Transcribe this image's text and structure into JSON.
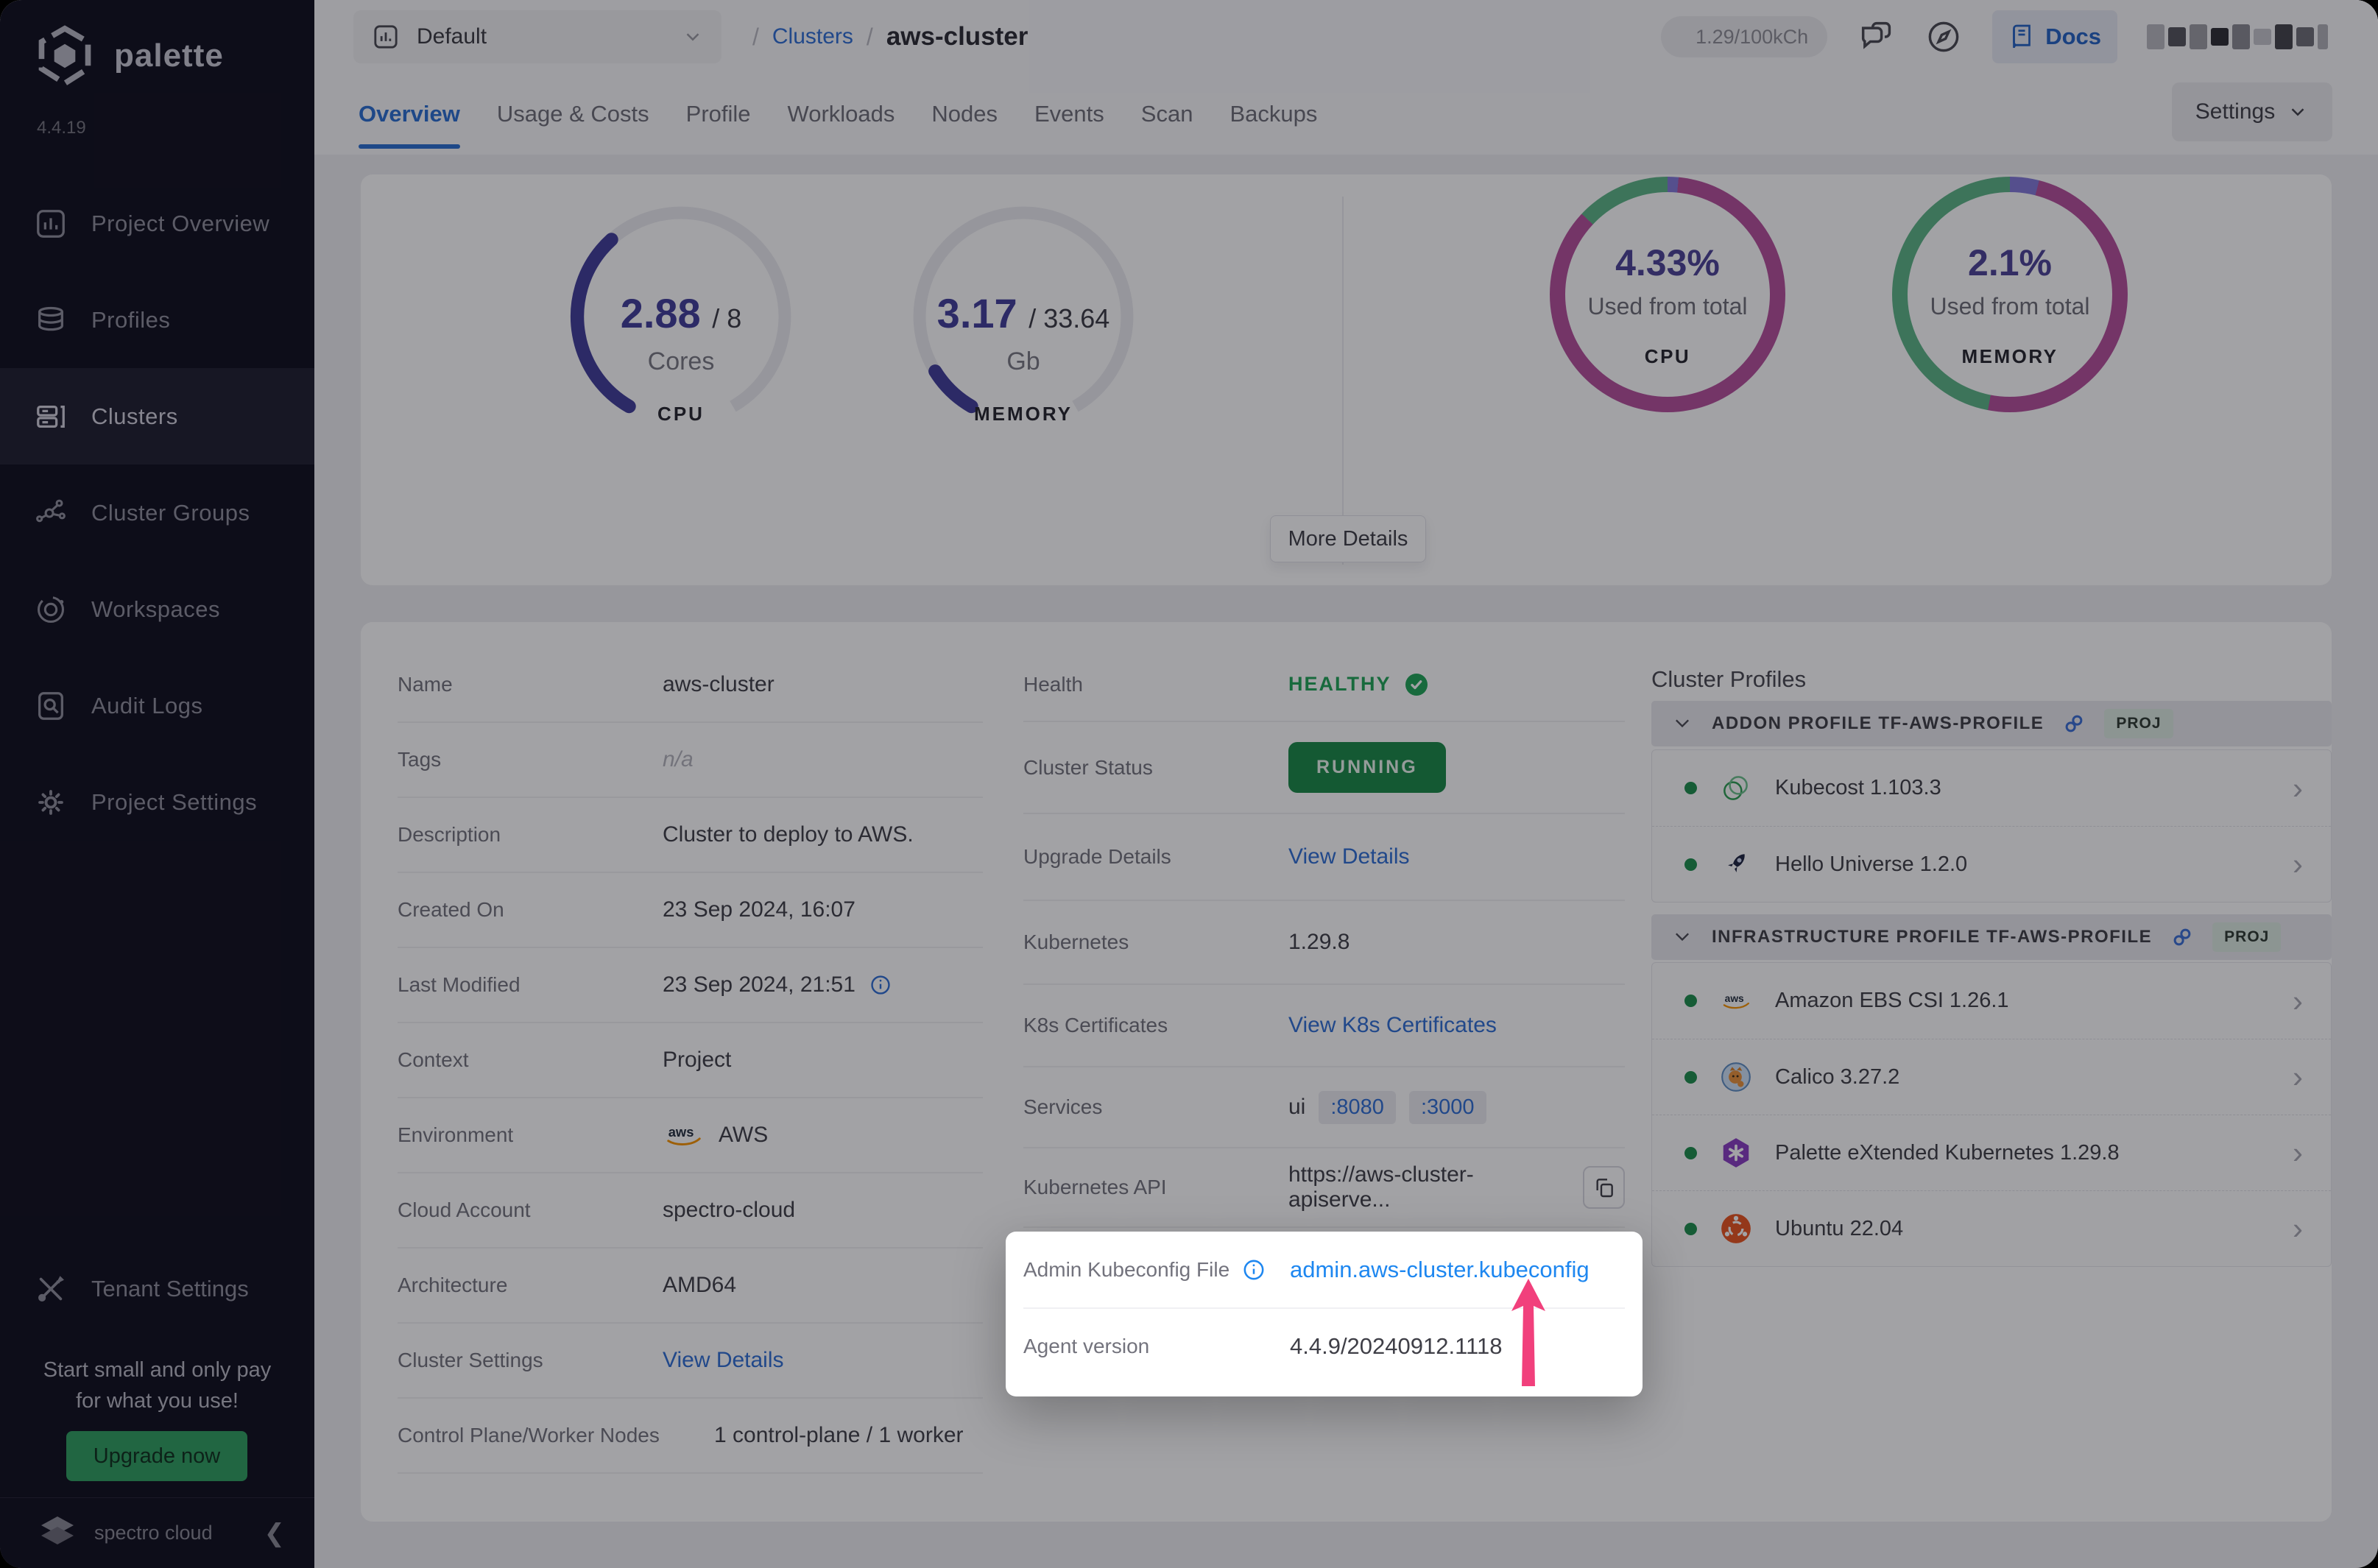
{
  "brand": {
    "name": "palette",
    "version": "4.4.19",
    "footer": "spectro cloud"
  },
  "sidebar": {
    "items": [
      {
        "label": "Project Overview",
        "icon": "bar-chart-icon"
      },
      {
        "label": "Profiles",
        "icon": "layers-icon"
      },
      {
        "label": "Clusters",
        "icon": "server-icon"
      },
      {
        "label": "Cluster Groups",
        "icon": "molecule-icon"
      },
      {
        "label": "Workspaces",
        "icon": "orbit-icon"
      },
      {
        "label": "Audit Logs",
        "icon": "audit-icon"
      },
      {
        "label": "Project Settings",
        "icon": "gear-icon"
      }
    ],
    "tenant_settings": "Tenant Settings",
    "promo": {
      "line1": "Start small and only pay",
      "line2": "for what you use!",
      "cta": "Upgrade now"
    }
  },
  "topbar": {
    "project": "Default",
    "breadcrumb": {
      "sep": "/",
      "root": "Clusters",
      "current": "aws-cluster"
    },
    "usage": "1.29/100kCh",
    "docs": "Docs"
  },
  "tabs": {
    "items": [
      "Overview",
      "Usage & Costs",
      "Profile",
      "Workloads",
      "Nodes",
      "Events",
      "Scan",
      "Backups"
    ],
    "settings": "Settings"
  },
  "overview": {
    "gauges": [
      {
        "value": "2.88",
        "total": "/ 8",
        "unit": "Cores",
        "label": "CPU",
        "pct": 36
      },
      {
        "value": "3.17",
        "total": "/ 33.64",
        "unit": "Gb",
        "label": "MEMORY",
        "pct": 9.4
      }
    ],
    "donuts": [
      {
        "value": "4.33%",
        "caption": "Used from total",
        "label": "CPU",
        "segments": [
          {
            "color": "#8379d8",
            "pct": 1.5
          },
          {
            "color": "#b5509c",
            "pct": 85.5
          },
          {
            "color": "#5cb586",
            "pct": 13
          }
        ]
      },
      {
        "value": "2.1%",
        "caption": "Used from total",
        "label": "MEMORY",
        "segments": [
          {
            "color": "#8379d8",
            "pct": 4
          },
          {
            "color": "#b5509c",
            "pct": 49
          },
          {
            "color": "#5cb586",
            "pct": 47
          }
        ]
      }
    ],
    "more_details": "More Details"
  },
  "details": {
    "left": [
      {
        "label": "Name",
        "value": "aws-cluster"
      },
      {
        "label": "Tags",
        "value": "n/a"
      },
      {
        "label": "Description",
        "value": "Cluster to deploy to AWS."
      },
      {
        "label": "Created On",
        "value": "23 Sep 2024, 16:07"
      },
      {
        "label": "Last Modified",
        "value": "23 Sep 2024, 21:51"
      },
      {
        "label": "Context",
        "value": "Project"
      },
      {
        "label": "Environment",
        "value": "AWS"
      },
      {
        "label": "Cloud Account",
        "value": "spectro-cloud"
      },
      {
        "label": "Architecture",
        "value": "AMD64"
      },
      {
        "label": "Cluster Settings",
        "value": "View Details"
      },
      {
        "label": "Control Plane/Worker Nodes",
        "value": "1 control-plane / 1 worker"
      }
    ],
    "middle": [
      {
        "label": "Health",
        "value": "HEALTHY"
      },
      {
        "label": "Cluster Status",
        "value": "RUNNING"
      },
      {
        "label": "Upgrade Details",
        "value": "View Details"
      },
      {
        "label": "Kubernetes",
        "value": "1.29.8"
      },
      {
        "label": "K8s Certificates",
        "value": "View K8s Certificates"
      },
      {
        "label": "Services",
        "value": "ui",
        "ports": [
          ":8080",
          ":3000"
        ]
      },
      {
        "label": "Kubernetes API",
        "value": "https://aws-cluster-apiserve..."
      }
    ],
    "highlight": {
      "rows": [
        {
          "label": "Admin Kubeconfig File",
          "value": "admin.aws-cluster.kubeconfig"
        },
        {
          "label": "Agent version",
          "value": "4.4.9/20240912.1118"
        }
      ]
    }
  },
  "profiles": {
    "heading": "Cluster Profiles",
    "badge": "PROJ",
    "groups": [
      {
        "title": "ADDON PROFILE TF-AWS-PROFILE",
        "items": [
          {
            "name": "Kubecost 1.103.3",
            "icon": "kubecost-icon"
          },
          {
            "name": "Hello Universe 1.2.0",
            "icon": "rocket-icon"
          }
        ]
      },
      {
        "title": "INFRASTRUCTURE PROFILE TF-AWS-PROFILE",
        "items": [
          {
            "name": "Amazon EBS CSI 1.26.1",
            "icon": "aws-icon"
          },
          {
            "name": "Calico 3.27.2",
            "icon": "calico-icon"
          },
          {
            "name": "Palette eXtended Kubernetes 1.29.8",
            "icon": "pxk-icon"
          },
          {
            "name": "Ubuntu 22.04",
            "icon": "ubuntu-icon"
          }
        ]
      }
    ]
  },
  "colors": {
    "accent_blue": "#2f6fd3",
    "bright_blue": "#1e87f0",
    "healthy_green": "#21a558",
    "running_bg": "#1a8a47",
    "gauge_purple": "#423e99",
    "donut_magenta": "#b5509c",
    "donut_green": "#5cb586",
    "donut_violet": "#8379d8",
    "arrow_pink": "#f1407c",
    "sidebar_bg": "#100f1d",
    "upgrade_green": "#2f9e5f"
  }
}
